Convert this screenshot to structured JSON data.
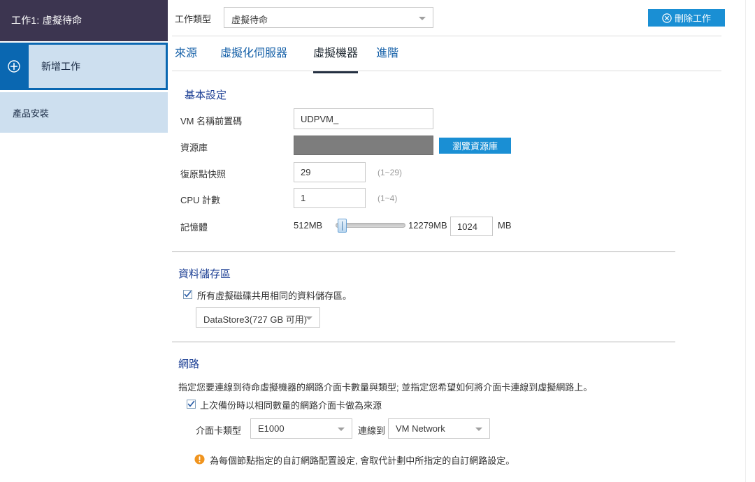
{
  "sidebar": {
    "job_title": "工作1: 虛擬待命",
    "add_job_label": "新增工作",
    "add_job_icon": "plus-circle-icon",
    "product_install_label": "產品安裝"
  },
  "topbar": {
    "job_type_label": "工作類型",
    "job_type_value": "虛擬待命",
    "delete_job_label": "刪除工作",
    "delete_job_icon": "x-circle-icon"
  },
  "tabs": [
    {
      "label": "來源",
      "active": false
    },
    {
      "label": "虛擬化伺服器",
      "active": false
    },
    {
      "label": "虛擬機器",
      "active": true
    },
    {
      "label": "進階",
      "active": false
    }
  ],
  "basic": {
    "heading": "基本設定",
    "vm_prefix_label": "VM 名稱前置碼",
    "vm_prefix_value": "UDPVM_",
    "repository_label": "資源庫",
    "repository_value": "",
    "browse_repository_label": "瀏覽資源庫",
    "snapshot_label": "復原點快照",
    "snapshot_value": "29",
    "snapshot_hint": "(1~29)",
    "cpu_label": "CPU 計數",
    "cpu_value": "1",
    "cpu_hint": "(1~4)",
    "memory_label": "記憶體",
    "memory_min": "512MB",
    "memory_max": "12279MB",
    "memory_value": "1024",
    "memory_unit": "MB",
    "memory_slider_percent": 4
  },
  "datastore": {
    "heading": "資料儲存區",
    "shared_checkbox_label": "所有虛擬磁碟共用相同的資料儲存區。",
    "shared_checked": true,
    "selected_store": "DataStore3(727 GB 可用)"
  },
  "network": {
    "heading": "網路",
    "description": "指定您要連線到待命虛擬機器的網路介面卡數量與類型; 並指定您希望如何將介面卡連線到虛擬網路上。",
    "same_nic_checkbox_label": "上次備份時以相同數量的網路介面卡做為來源",
    "same_nic_checked": true,
    "nic_type_label": "介面卡類型",
    "nic_type_value": "E1000",
    "connect_to_label": "連線到",
    "connect_to_value": "VM Network",
    "warning_icon": "warning-icon",
    "warning_text": "為每個節點指定的自訂網路配置設定, 會取代計劃中所指定的自訂網路設定。"
  },
  "colors": {
    "title_bar": "#3c3550",
    "accent_blue": "#0a67b1",
    "light_blue_panel": "#cddfef",
    "button_blue": "#1a8fd4",
    "heading_blue": "#1c3f94",
    "tab_link": "#1560a8",
    "warning_orange": "#f0941e",
    "disabled_gray": "#7d7d7d"
  }
}
